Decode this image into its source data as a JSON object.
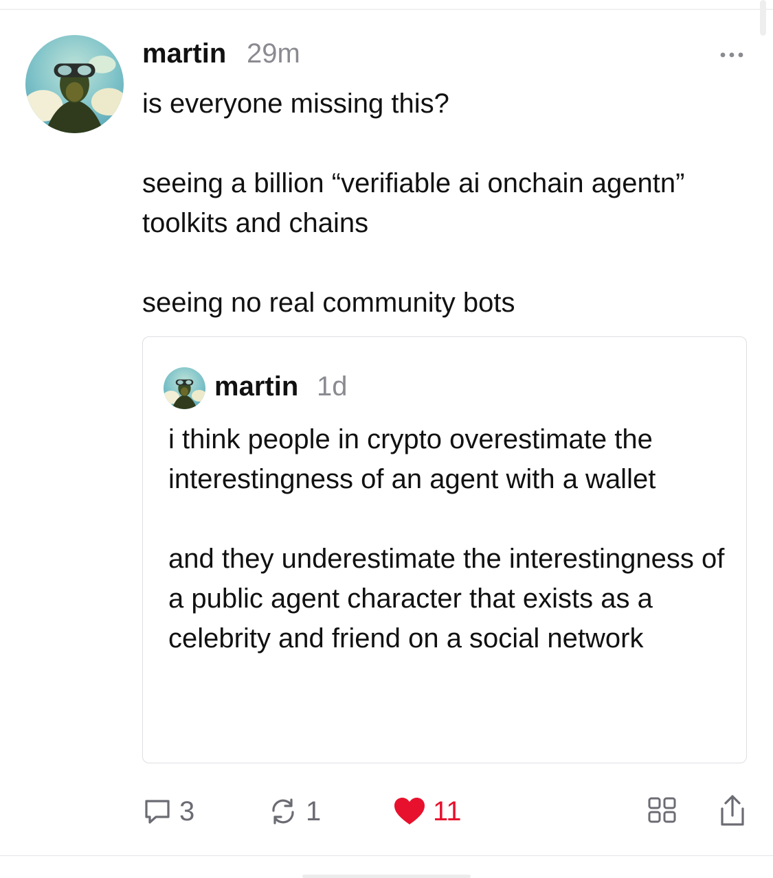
{
  "post": {
    "author": "martin",
    "time": "29m",
    "paragraphs": [
      "is everyone missing this?",
      "seeing a billion “verifiable ai onchain agentn” toolkits and chains",
      "seeing no real community bots"
    ]
  },
  "quote": {
    "author": "martin",
    "time": "1d",
    "paragraphs": [
      "i think people in crypto overestimate the interestingness of an agent with a wallet",
      "and they underestimate the interestingness of a public agent character that exists as a celebrity and friend on a social network"
    ]
  },
  "actions": {
    "replies": "3",
    "recasts": "1",
    "likes": "11"
  },
  "icons": {
    "more": "more-dots-icon",
    "reply": "speech-bubble-icon",
    "recast": "recast-arrows-icon",
    "like": "heart-icon",
    "grid": "grid-icon",
    "share": "share-icon"
  },
  "colors": {
    "like": "#e8112d",
    "muted": "#8a8a91",
    "border": "#dedee3"
  }
}
